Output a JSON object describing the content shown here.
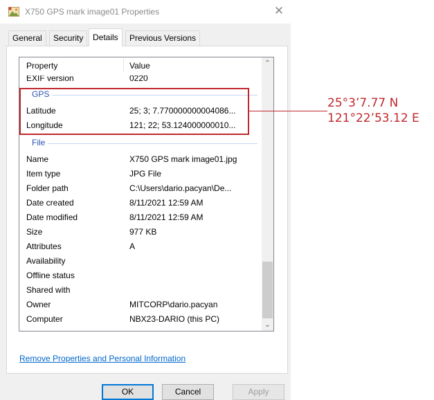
{
  "window": {
    "title": "X750 GPS mark image01 Properties",
    "close_glyph": "✕",
    "icon": "image-file-icon"
  },
  "tabs": [
    {
      "label": "General",
      "active": false
    },
    {
      "label": "Security",
      "active": false
    },
    {
      "label": "Details",
      "active": true
    },
    {
      "label": "Previous Versions",
      "active": false
    }
  ],
  "list": {
    "header": {
      "property": "Property",
      "value": "Value"
    },
    "partial_row": {
      "name": "EXIF version",
      "value": "0220"
    },
    "groups": {
      "gps": {
        "label": "GPS",
        "rows": [
          {
            "name": "Latitude",
            "value": "25; 3; 7.770000000004086..."
          },
          {
            "name": "Longitude",
            "value": "121; 22; 53.124000000010..."
          }
        ]
      },
      "file": {
        "label": "File",
        "rows": [
          {
            "name": "Name",
            "value": "X750 GPS mark image01.jpg"
          },
          {
            "name": "Item type",
            "value": "JPG File"
          },
          {
            "name": "Folder path",
            "value": "C:\\Users\\dario.pacyan\\De..."
          },
          {
            "name": "Date created",
            "value": "8/11/2021 12:59 AM"
          },
          {
            "name": "Date modified",
            "value": "8/11/2021 12:59 AM"
          },
          {
            "name": "Size",
            "value": "977 KB"
          },
          {
            "name": "Attributes",
            "value": "A"
          },
          {
            "name": "Availability",
            "value": ""
          },
          {
            "name": "Offline status",
            "value": ""
          },
          {
            "name": "Shared with",
            "value": ""
          },
          {
            "name": "Owner",
            "value": "MITCORP\\dario.pacyan"
          },
          {
            "name": "Computer",
            "value": "NBX23-DARIO (this PC)"
          }
        ]
      }
    },
    "scroll": {
      "up_glyph": "⌃",
      "down_glyph": "⌄"
    }
  },
  "callout": {
    "lines": [
      "25°3’7.77 N",
      "121°22’53.12 E"
    ],
    "color": "#c0272d"
  },
  "remove_link": "Remove Properties and Personal Information",
  "buttons": {
    "ok": "OK",
    "cancel": "Cancel",
    "apply": "Apply"
  },
  "colors": {
    "group_label": "#2c53b4",
    "link": "#0066cc",
    "highlight": "#c0272d"
  }
}
